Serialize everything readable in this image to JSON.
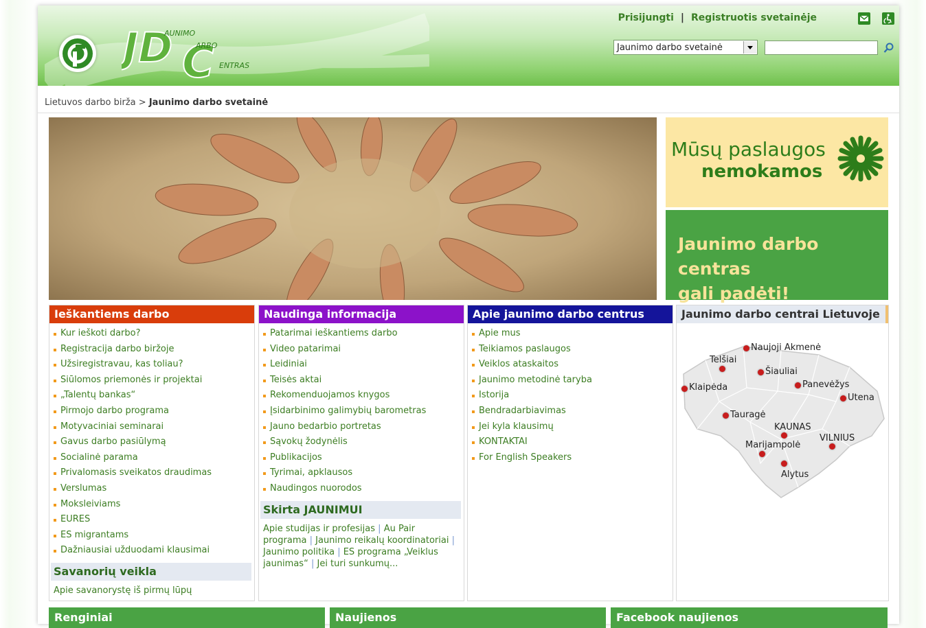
{
  "header": {
    "login_link": "Prisijungti",
    "register_link": "Registruotis svetainėje",
    "site_select_value": "Jaunimo darbo svetainė",
    "search_value": "",
    "logo_text_1": "AUNIMO",
    "logo_text_2": "ARBO",
    "logo_text_3": "ENTRAS",
    "icons": [
      "mail-icon",
      "accessibility-icon",
      "search-icon"
    ]
  },
  "breadcrumb": {
    "parent": "Lietuvos darbo birža",
    "separator": ">",
    "current": "Jaunimo darbo svetainė"
  },
  "promo": {
    "services_line1": "Mūsų paslaugos",
    "services_line2": "nemokamos",
    "help_line1": "Jaunimo darbo centras",
    "help_line2": "gali padėti!"
  },
  "columns": {
    "job_seekers": {
      "title": "Ieškantiems darbo",
      "color": "#d93d0b",
      "items": [
        "Kur ieškoti darbo?",
        "Registracija darbo biržoje",
        "Užsiregistravau, kas toliau?",
        "Siūlomos priemonės ir projektai",
        "„Talentų bankas“",
        "Pirmojo darbo programa",
        "Motyvaciniai seminarai",
        "Gavus darbo pasiūlymą",
        "Socialinė parama",
        "Privalomasis sveikatos draudimas",
        "Verslumas",
        "Moksleiviams",
        "EURES",
        "ES migrantams",
        "Dažniausiai užduodami klausimai"
      ],
      "volunteer_title": "Savanorių veikla",
      "volunteer_link": "Apie savanorystę iš pirmų lūpų"
    },
    "useful_info": {
      "title": "Naudinga informacija",
      "color": "#8c12c9",
      "items": [
        "Patarimai ieškantiems darbo",
        "Video patarimai",
        "Leidiniai",
        "Teisės aktai",
        "Rekomenduojamos knygos",
        "Įsidarbinimo galimybių barometras",
        "Jauno bedarbio portretas",
        "Sąvokų žodynėlis",
        "Publikacijos",
        "Tyrimai, apklausos",
        "Naudingos nuorodos"
      ],
      "youth_title": "Skirta JAUNIMUI",
      "youth_links": [
        "Apie studijas ir profesijas",
        "Au Pair programa",
        "Jaunimo reikalų koordinatoriai",
        "Jaunimo politika",
        "ES programa „Veiklus jaunimas“",
        "Jei turi sunkumų..."
      ],
      "youth_separator": "|"
    },
    "about_centers": {
      "title": "Apie jaunimo darbo centrus",
      "color": "#14149a",
      "items": [
        "Apie mus",
        "Teikiamos paslaugos",
        "Veiklos ataskaitos",
        "Jaunimo metodinė taryba",
        "Istorija",
        "Bendradarbiavimas",
        "Jei kyla klausimų",
        "KONTAKTAI",
        "For English Speakers"
      ]
    },
    "map": {
      "title": "Jaunimo darbo centrai Lietuvoje",
      "cities": [
        "Naujoji Akmenė",
        "Telšiai",
        "Šiauliai",
        "Panevėžys",
        "Klaipėda",
        "Utena",
        "Tauragė",
        "KAUNAS",
        "VILNIUS",
        "Marijampolė",
        "Alytus"
      ]
    }
  },
  "bottom": {
    "events": "Renginiai",
    "news": "Naujienos",
    "facebook": "Facebook naujienos"
  },
  "colors": {
    "brand_green": "#4aa344",
    "link_green": "#3c7d22",
    "bullet_orange": "#f29a1b",
    "promo_yellow": "#fce7a4"
  }
}
